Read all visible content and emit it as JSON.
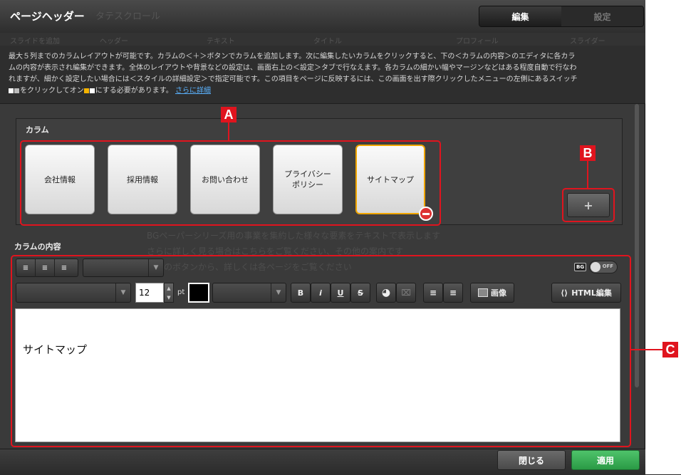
{
  "dialog": {
    "title": "ページヘッダー",
    "background_title": "タテスクロール",
    "tabs": [
      {
        "label": "編集",
        "active": true
      },
      {
        "label": "設定",
        "active": false
      }
    ],
    "background_row": [
      "スライドを追加",
      "ヘッダー",
      "テキスト",
      "タイトル",
      "プロフィール",
      "スライダー"
    ]
  },
  "description": {
    "line1": "最大５列までのカラムレイアウトが可能です。カラムの＜＋＞ボタンでカラムを追加します。次に編集したいカラムをクリックすると、下の＜カラムの内容＞のエディタに各カラ",
    "line2": "ムの内容が表示され編集ができます。全体のレイアウトや背景などの設定は、画面右上の＜設定＞タブで行なえます。各カラムの細かい幅やマージンなどはある程度自動で行なわ",
    "line3": "れますが、細かく設定したい場合には＜スタイルの詳細設定＞で指定可能です。この項目をページに反映するには、この画面を出す際クリックしたメニューの左側にあるスイッチ",
    "line4_pre": "をクリックしてオン",
    "line4_post": "にする必要があります。",
    "link": "さらに詳細"
  },
  "columns": {
    "heading": "カラム",
    "items": [
      {
        "label": "会社情報",
        "selected": false
      },
      {
        "label": "採用情報",
        "selected": false
      },
      {
        "label": "お問い合わせ",
        "selected": false
      },
      {
        "label": "プライバシーポリシー",
        "line1": "プライバシー",
        "line2": "ポリシー",
        "selected": false
      },
      {
        "label": "サイトマップ",
        "selected": true
      }
    ],
    "add_symbol": "+"
  },
  "content": {
    "heading": "カラムの内容",
    "ghost_lines": [
      "BGペーパーシリーズ用の事業を集約した様々な要素をテキストで表示します",
      "さらに詳しく見る場合はこちらをご覧ください、その他の案内です",
      "下記のボタンから、詳しくは各ページをご覧ください"
    ],
    "toolbar": {
      "bg_label": "BG",
      "toggle_label": "OFF",
      "font_size": "12",
      "font_unit": "pt",
      "text_color": "#000000",
      "bold": "B",
      "italic": "i",
      "underline": "U",
      "strike": "S",
      "image_label": "画像",
      "html_label": "HTML編集"
    },
    "editor_text": "サイトマップ"
  },
  "callouts": {
    "a": "A",
    "b": "B",
    "c": "C"
  },
  "footer": {
    "close_label": "閉じる",
    "apply_label": "適用"
  },
  "colors": {
    "callout": "#e0141e",
    "selected_border": "#f0a500",
    "apply": "#2a9a45",
    "link": "#5bb3ff"
  }
}
